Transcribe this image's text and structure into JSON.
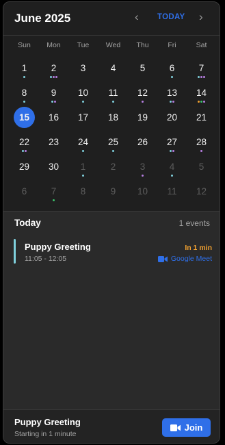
{
  "header": {
    "month_label": "June 2025",
    "prev_glyph": "‹",
    "next_glyph": "›",
    "today_label": "TODAY"
  },
  "weekdays": [
    "Sun",
    "Mon",
    "Tue",
    "Wed",
    "Thu",
    "Fri",
    "Sat"
  ],
  "event_colors": {
    "teal": "#7fd0dc",
    "purple": "#b57ee0",
    "green": "#3bbf6a",
    "orange": "#f0a030",
    "pink": "#e46bd2",
    "accent": "#2f6fe8"
  },
  "weeks": [
    [
      {
        "label": "1",
        "dots": [
          "teal"
        ]
      },
      {
        "label": "2",
        "dots": [
          "teal",
          "purple",
          "purple"
        ]
      },
      {
        "label": "3",
        "dots": []
      },
      {
        "label": "4",
        "dots": []
      },
      {
        "label": "5",
        "dots": []
      },
      {
        "label": "6",
        "dots": [
          "teal"
        ]
      },
      {
        "label": "7",
        "dots": [
          "teal",
          "purple",
          "purple"
        ]
      }
    ],
    [
      {
        "label": "8",
        "dots": [
          "teal"
        ]
      },
      {
        "label": "9",
        "dots": [
          "teal",
          "purple"
        ]
      },
      {
        "label": "10",
        "dots": [
          "teal"
        ]
      },
      {
        "label": "11",
        "dots": [
          "teal"
        ]
      },
      {
        "label": "12",
        "dots": [
          "purple"
        ]
      },
      {
        "label": "13",
        "dots": [
          "teal",
          "purple"
        ]
      },
      {
        "label": "14",
        "dots": [
          "orange",
          "green",
          "purple"
        ]
      }
    ],
    [
      {
        "label": "15",
        "dots": [],
        "selected": true
      },
      {
        "label": "16",
        "dots": []
      },
      {
        "label": "17",
        "dots": []
      },
      {
        "label": "18",
        "dots": []
      },
      {
        "label": "19",
        "dots": []
      },
      {
        "label": "20",
        "dots": []
      },
      {
        "label": "21",
        "dots": []
      }
    ],
    [
      {
        "label": "22",
        "dots": [
          "teal",
          "purple"
        ]
      },
      {
        "label": "23",
        "dots": []
      },
      {
        "label": "24",
        "dots": [
          "teal"
        ]
      },
      {
        "label": "25",
        "dots": [
          "teal"
        ]
      },
      {
        "label": "26",
        "dots": []
      },
      {
        "label": "27",
        "dots": [
          "teal",
          "purple"
        ]
      },
      {
        "label": "28",
        "dots": [
          "purple"
        ]
      }
    ],
    [
      {
        "label": "29",
        "dots": []
      },
      {
        "label": "30",
        "dots": []
      },
      {
        "label": "1",
        "dots": [
          "teal"
        ],
        "other_month": true
      },
      {
        "label": "2",
        "dots": [],
        "other_month": true
      },
      {
        "label": "3",
        "dots": [
          "purple"
        ],
        "other_month": true
      },
      {
        "label": "4",
        "dots": [
          "teal"
        ],
        "other_month": true
      },
      {
        "label": "5",
        "dots": [],
        "other_month": true
      }
    ],
    [
      {
        "label": "6",
        "dots": [],
        "other_month": true
      },
      {
        "label": "7",
        "dots": [
          "green"
        ],
        "other_month": true
      },
      {
        "label": "8",
        "dots": [],
        "other_month": true
      },
      {
        "label": "9",
        "dots": [],
        "other_month": true
      },
      {
        "label": "10",
        "dots": [],
        "other_month": true
      },
      {
        "label": "11",
        "dots": [],
        "other_month": true
      },
      {
        "label": "12",
        "dots": [],
        "other_month": true
      }
    ]
  ],
  "today_section": {
    "title": "Today",
    "count": "1 events",
    "events": [
      {
        "title": "Puppy Greeting",
        "time": "11:05 - 12:05",
        "starts_in": "In 1 min",
        "meeting_service": "Google Meet",
        "bar_color": "teal"
      }
    ]
  },
  "footer": {
    "title": "Puppy Greeting",
    "subtitle": "Starting in 1 minute",
    "join_label": "Join"
  }
}
